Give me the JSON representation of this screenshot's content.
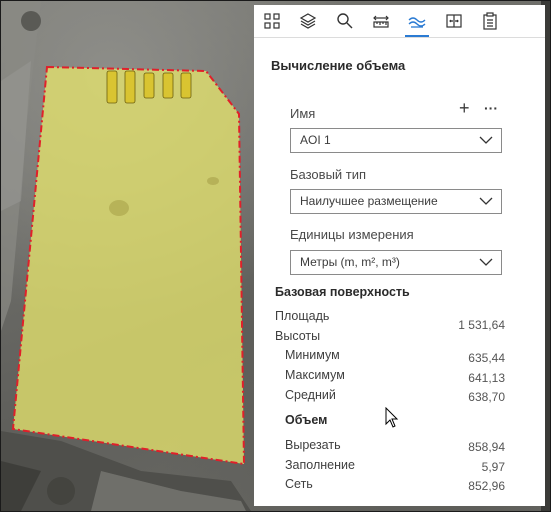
{
  "toolbar": {
    "tools": [
      {
        "name": "select-tool-icon"
      },
      {
        "name": "layers-icon"
      },
      {
        "name": "search-icon"
      },
      {
        "name": "distance-measure-icon"
      },
      {
        "name": "volume-measure-icon",
        "active": true
      },
      {
        "name": "compare-icon"
      },
      {
        "name": "clipboard-icon"
      }
    ]
  },
  "panel": {
    "title": "Вычисление объема",
    "name_label": "Имя",
    "name_value": "AOI 1",
    "base_type_label": "Базовый тип",
    "base_type_value": "Наилучшее размещение",
    "units_label": "Единицы измерения",
    "units_value": "Метры (m, m², m³)",
    "add_button": "+",
    "more_button": "···",
    "base_surface_title": "Базовая поверхность",
    "area_label": "Площадь",
    "area_value": "1 531,64",
    "heights_label": "Высоты",
    "min_label": "Минимум",
    "min_value": "635,44",
    "max_label": "Максимум",
    "max_value": "641,13",
    "avg_label": "Средний",
    "avg_value": "638,70",
    "volume_title": "Объем",
    "cut_label": "Вырезать",
    "cut_value": "858,94",
    "fill_label": "Заполнение",
    "fill_value": "5,97",
    "net_label": "Сеть",
    "net_value": "852,96"
  },
  "colors": {
    "polygon_fill": "#e4e36d",
    "polygon_outline": "#e0202a",
    "active_tab": "#2b7bd3"
  }
}
